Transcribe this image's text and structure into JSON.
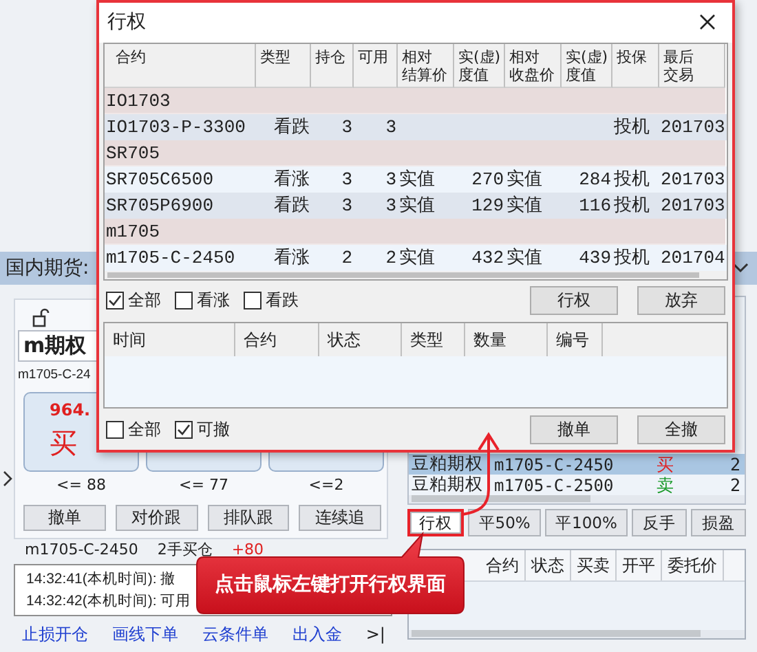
{
  "dialog": {
    "title": "行权",
    "columns": [
      [
        "合约"
      ],
      [
        "类型"
      ],
      [
        "持仓"
      ],
      [
        "可用"
      ],
      [
        "相对",
        "结算价"
      ],
      [
        "实(虚)",
        "度值"
      ],
      [
        "相对",
        "收盘价"
      ],
      [
        "实(虚)",
        "度值"
      ],
      [
        "投保"
      ],
      [
        "最后",
        "交易"
      ]
    ],
    "rows": [
      {
        "kind": "group",
        "contract": "IO1703"
      },
      {
        "kind": "option",
        "cells": [
          "IO1703-P-3300",
          "看跌",
          "3",
          "3",
          "",
          "",
          "",
          "",
          "投机",
          "201703"
        ]
      },
      {
        "kind": "group",
        "contract": "SR705"
      },
      {
        "kind": "option",
        "cells": [
          "SR705C6500",
          "看涨",
          "3",
          "3",
          "实值",
          "270",
          "实值",
          "284",
          "投机",
          "201703"
        ]
      },
      {
        "kind": "option",
        "cells": [
          "SR705P6900",
          "看跌",
          "3",
          "3",
          "实值",
          "129",
          "实值",
          "116",
          "投机",
          "201703"
        ]
      },
      {
        "kind": "group",
        "contract": "m1705"
      },
      {
        "kind": "option",
        "cells": [
          "m1705-C-2450",
          "看涨",
          "2",
          "2",
          "实值",
          "432",
          "实值",
          "439",
          "投机",
          "201704"
        ]
      }
    ],
    "filters": [
      {
        "label": "全部",
        "checked": true
      },
      {
        "label": "看涨",
        "checked": false
      },
      {
        "label": "看跌",
        "checked": false
      }
    ],
    "actions": [
      "行权",
      "放弃"
    ],
    "order_columns": [
      "时间",
      "合约",
      "状态",
      "类型",
      "数量",
      "编号"
    ],
    "order_filters": [
      {
        "label": "全部",
        "checked": false
      },
      {
        "label": "可撤",
        "checked": true
      }
    ],
    "order_actions": [
      "撤单",
      "全撤"
    ]
  },
  "market_tab": "国内期货:",
  "order_panel": {
    "product": "m期权",
    "contract": "m1705-C-24",
    "quotes": [
      {
        "price": "964.",
        "action": "买",
        "limit": "<= 88"
      },
      {
        "limit": "<= 77"
      },
      {
        "limit": "<=2"
      }
    ],
    "buttons": [
      "撤单",
      "对价跟",
      "排队跟",
      "连续追"
    ],
    "summary": {
      "contract": "m1705-C-2450",
      "position": "2手买仓",
      "change": "+80"
    },
    "log": [
      "14:32:41(本机时间): 撤",
      "14:32:42(本机时间): 可用"
    ],
    "links": [
      "止损开仓",
      "画线下单",
      "云条件单",
      "出入金"
    ],
    "more": ">|"
  },
  "positions": [
    {
      "name": "豆粕期权",
      "contract": "m1705-C-2450",
      "side": "买",
      "color": "#e02020",
      "qty": "2",
      "selected": true
    },
    {
      "name": "豆粕期权",
      "contract": "m1705-C-2500",
      "side": "卖",
      "color": "#1a9a2a",
      "qty": "2",
      "selected": false
    }
  ],
  "position_buttons": [
    {
      "label": "行权",
      "highlighted": true
    },
    {
      "label": "平50%",
      "highlighted": false
    },
    {
      "label": "平100%",
      "highlighted": false
    },
    {
      "label": "反手",
      "highlighted": false
    },
    {
      "label": "损盈",
      "highlighted": false
    }
  ],
  "order_columns": [
    "合约",
    "状态",
    "买卖",
    "开平",
    "委托价"
  ],
  "callout": "点击鼠标左键打开行权界面"
}
